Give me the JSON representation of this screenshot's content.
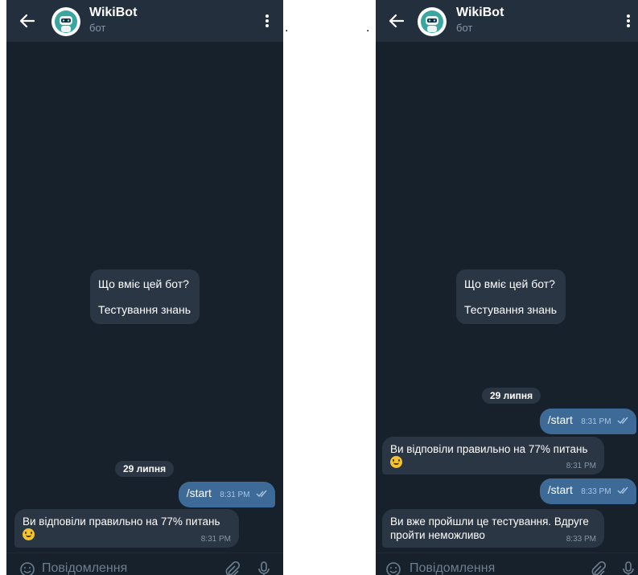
{
  "chat": {
    "bot_name": "WikiBot",
    "bot_subtitle": "бот",
    "intro_title": "Що вміє цей бот?",
    "intro_text": "Тестування знань",
    "date": "29 липня",
    "input_placeholder": "Повідомлення"
  },
  "separator_dots": ".",
  "left_messages": [
    {
      "from": "user",
      "text": "/start",
      "time": "8:31 PM"
    },
    {
      "from": "bot",
      "text": "Ви відповіли правильно на 77% питань",
      "time": "8:31 PM",
      "emoji": "grinning-face"
    }
  ],
  "right_messages": [
    {
      "from": "user",
      "text": "/start",
      "time": "8:31 PM"
    },
    {
      "from": "bot",
      "text": "Ви відповіли правильно на 77% питань",
      "time": "8:31 PM",
      "emoji": "grinning-face"
    },
    {
      "from": "user",
      "text": "/start",
      "time": "8:33 PM"
    },
    {
      "from": "bot",
      "text_line1": "Ви вже пройшли це тестування. Вдруге",
      "text_line2": "пройти неможливо",
      "time": "8:33 PM"
    }
  ],
  "colors": {
    "chat_background": "#17212b",
    "header": "#242f3d",
    "incoming_bubble": "#2b3644",
    "outgoing_bubble": "#3d6a97"
  }
}
